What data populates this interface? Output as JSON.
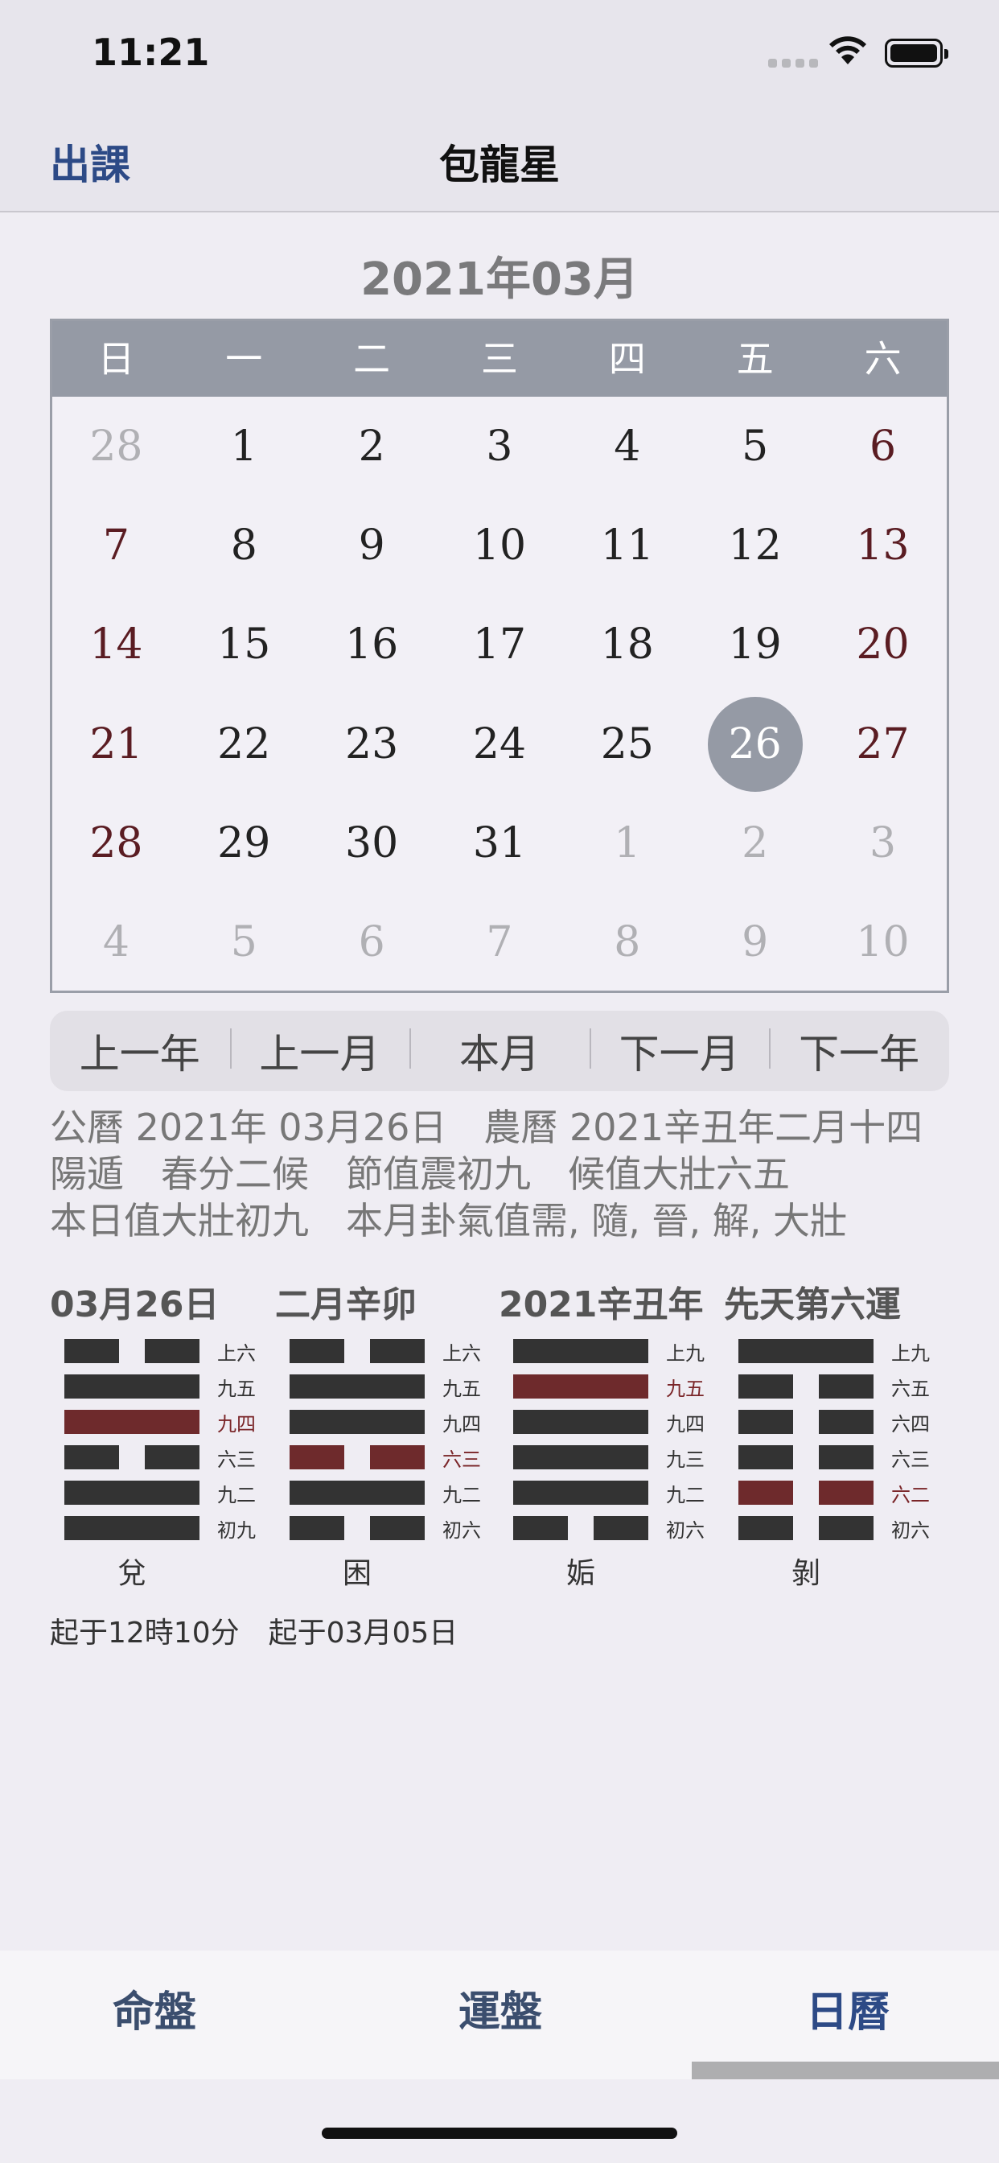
{
  "status": {
    "time": "11:21"
  },
  "nav": {
    "back": "出課",
    "title": "包龍星"
  },
  "calendar": {
    "title": "2021年03月",
    "weekdays": [
      "日",
      "一",
      "二",
      "三",
      "四",
      "五",
      "六"
    ],
    "days": [
      "28",
      "1",
      "2",
      "3",
      "4",
      "5",
      "6",
      "7",
      "8",
      "9",
      "10",
      "11",
      "12",
      "13",
      "14",
      "15",
      "16",
      "17",
      "18",
      "19",
      "20",
      "21",
      "22",
      "23",
      "24",
      "25",
      "26",
      "27",
      "28",
      "29",
      "30",
      "31",
      "1",
      "2",
      "3",
      "4",
      "5",
      "6",
      "7",
      "8",
      "9",
      "10"
    ],
    "selected": "26"
  },
  "segment": [
    "上一年",
    "上一月",
    "本月",
    "下一月",
    "下一年"
  ],
  "info": {
    "line1": "公曆 2021年 03月26日　農曆 2021辛丑年二月十四",
    "line2": "陽遁　春分二候　節值震初九　候值大壯六五",
    "line3": "本日值大壯初九　本月卦氣值需, 隨, 晉, 解, 大壯"
  },
  "hex_header": {
    "a": "03月26日",
    "b": "二月辛卯",
    "c": "2021辛丑年",
    "d": "先天第六運"
  },
  "hexagrams": [
    {
      "name": "兌",
      "lines": [
        {
          "label": "上六",
          "yin": true,
          "red": false
        },
        {
          "label": "九五",
          "yin": false,
          "red": false
        },
        {
          "label": "九四",
          "yin": false,
          "red": true
        },
        {
          "label": "六三",
          "yin": true,
          "red": false
        },
        {
          "label": "九二",
          "yin": false,
          "red": false
        },
        {
          "label": "初九",
          "yin": false,
          "red": false
        }
      ]
    },
    {
      "name": "困",
      "lines": [
        {
          "label": "上六",
          "yin": true,
          "red": false
        },
        {
          "label": "九五",
          "yin": false,
          "red": false
        },
        {
          "label": "九四",
          "yin": false,
          "red": false
        },
        {
          "label": "六三",
          "yin": true,
          "red": true
        },
        {
          "label": "九二",
          "yin": false,
          "red": false
        },
        {
          "label": "初六",
          "yin": true,
          "red": false
        }
      ]
    },
    {
      "name": "姤",
      "lines": [
        {
          "label": "上九",
          "yin": false,
          "red": false
        },
        {
          "label": "九五",
          "yin": false,
          "red": true
        },
        {
          "label": "九四",
          "yin": false,
          "red": false
        },
        {
          "label": "九三",
          "yin": false,
          "red": false
        },
        {
          "label": "九二",
          "yin": false,
          "red": false
        },
        {
          "label": "初六",
          "yin": true,
          "red": false
        }
      ]
    },
    {
      "name": "剝",
      "lines": [
        {
          "label": "上九",
          "yin": false,
          "red": false
        },
        {
          "label": "六五",
          "yin": true,
          "red": false
        },
        {
          "label": "六四",
          "yin": true,
          "red": false
        },
        {
          "label": "六三",
          "yin": true,
          "red": false
        },
        {
          "label": "六二",
          "yin": true,
          "red": true
        },
        {
          "label": "初六",
          "yin": true,
          "red": false
        }
      ]
    }
  ],
  "since": {
    "a": "起于12時10分",
    "b": "起于03月05日"
  },
  "tabs": [
    "命盤",
    "運盤",
    "日曆"
  ]
}
